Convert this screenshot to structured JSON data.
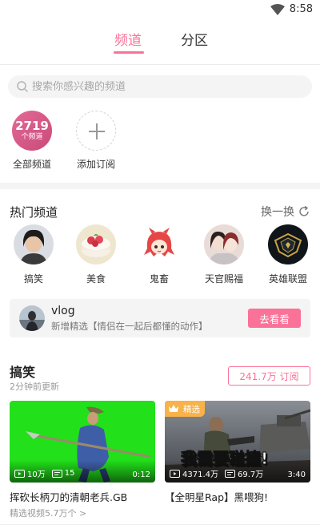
{
  "status": {
    "time": "8:58"
  },
  "tabs": [
    {
      "label": "频道",
      "active": true
    },
    {
      "label": "分区",
      "active": false
    }
  ],
  "search": {
    "placeholder": "搜索你感兴趣的频道"
  },
  "quick": {
    "all_count": "2719",
    "all_unit": "个频道",
    "all_label": "全部频道",
    "add_label": "添加订阅"
  },
  "hot": {
    "title": "热门频道",
    "refresh_label": "换一换",
    "items": [
      {
        "label": "搞笑",
        "icon": "person-avatar"
      },
      {
        "label": "美食",
        "icon": "cake-avatar"
      },
      {
        "label": "鬼畜",
        "icon": "anime-girl-avatar"
      },
      {
        "label": "天官赐福",
        "icon": "anime-pair-avatar"
      },
      {
        "label": "英雄联盟",
        "icon": "league-logo"
      }
    ]
  },
  "vlog": {
    "title": "vlog",
    "desc": "新增精选【情侣在一起后都懂的动作】",
    "button": "去看看"
  },
  "section": {
    "title": "搞笑",
    "updated": "2分钟前更新",
    "subscribe": "241.7万 订阅",
    "videos": [
      {
        "title": "挥砍长柄刀的清朝老兵.GB",
        "plays": "10万",
        "danmaku": "15",
        "duration": "0:12",
        "badge": ""
      },
      {
        "title": "【全明星Rap】黑喂狗!",
        "plays": "4371.4万",
        "danmaku": "69.7万",
        "duration": "3:40",
        "badge": "精选",
        "thumb_text": "我需要碰撞!"
      }
    ],
    "more": "精选视频5.7万个 >"
  },
  "colors": {
    "accent": "#fb7299",
    "badge": "#f7b24a"
  }
}
